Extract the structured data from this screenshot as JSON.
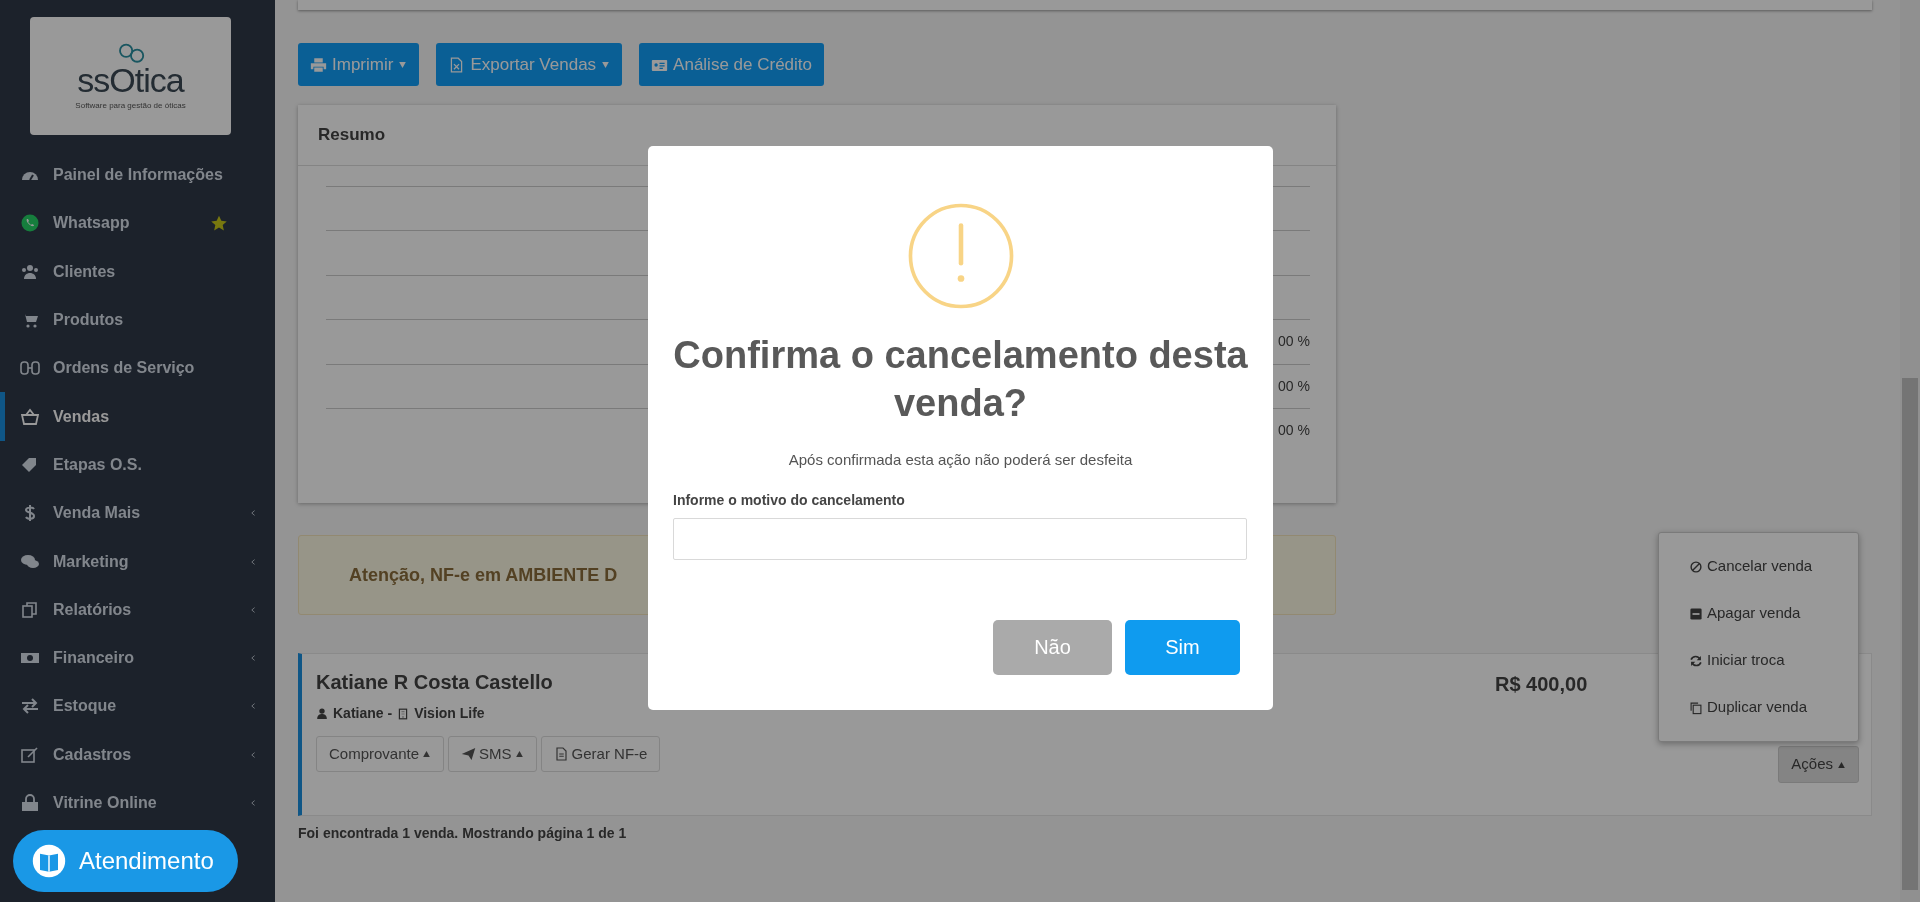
{
  "sidebar": {
    "logo": {
      "text": "ssOtica",
      "tagline": "Software para gestão de óticas"
    },
    "items": [
      {
        "label": "Painel de Informações",
        "selected": false,
        "starred": false,
        "expandable": false
      },
      {
        "label": "Whatsapp",
        "selected": false,
        "starred": true,
        "expandable": false
      },
      {
        "label": "Clientes",
        "selected": false,
        "starred": false,
        "expandable": false
      },
      {
        "label": "Produtos",
        "selected": false,
        "starred": false,
        "expandable": false
      },
      {
        "label": "Ordens de Serviço",
        "selected": false,
        "starred": false,
        "expandable": false
      },
      {
        "label": "Vendas",
        "selected": true,
        "starred": false,
        "expandable": false
      },
      {
        "label": "Etapas O.S.",
        "selected": false,
        "starred": false,
        "expandable": false
      },
      {
        "label": "Venda Mais",
        "selected": false,
        "starred": false,
        "expandable": true
      },
      {
        "label": "Marketing",
        "selected": false,
        "starred": false,
        "expandable": true
      },
      {
        "label": "Relatórios",
        "selected": false,
        "starred": false,
        "expandable": true
      },
      {
        "label": "Financeiro",
        "selected": false,
        "starred": false,
        "expandable": true
      },
      {
        "label": "Estoque",
        "selected": false,
        "starred": false,
        "expandable": true
      },
      {
        "label": "Cadastros",
        "selected": false,
        "starred": false,
        "expandable": true
      },
      {
        "label": "Vitrine Online",
        "selected": false,
        "starred": false,
        "expandable": true
      }
    ]
  },
  "toolbar": [
    {
      "label": "Imprimir",
      "caret": true
    },
    {
      "label": "Exportar Vendas",
      "caret": true
    },
    {
      "label": "Análise de Crédito",
      "caret": false
    }
  ],
  "resumo": {
    "title": "Resumo",
    "rows": [
      {
        "kind": "blank"
      },
      {
        "kind": "blank"
      },
      {
        "kind": "blank"
      },
      {
        "kind": "value",
        "column_last": "00 %"
      },
      {
        "kind": "value",
        "column_last": "00 %"
      },
      {
        "kind": "value",
        "column_last": "00 %"
      }
    ]
  },
  "alert": "Atenção, NF-e em AMBIENTE D",
  "sale": {
    "customer": "Katiane R Costa Castello",
    "seller": "Katiane -",
    "store": "Vision Life",
    "total": "R$ 400,00",
    "buttons": [
      {
        "label": "Comprovante",
        "caret": true
      },
      {
        "label": "SMS",
        "caret": true
      },
      {
        "label": "Gerar NF-e",
        "caret": false
      }
    ],
    "actions": {
      "label": "Ações",
      "expanded": true,
      "items": [
        "Cancelar venda",
        "Apagar venda",
        "Iniciar troca",
        "Duplicar venda"
      ]
    }
  },
  "footer": "Foi encontrada 1 venda. Mostrando página 1 de 1",
  "dialog": {
    "title": "Confirma o cancelamento desta venda?",
    "message": "Após confirmada esta ação não poderá ser desfeita",
    "field_label": "Informe o motivo do cancelamento",
    "buttons": [
      {
        "label": "Não",
        "kind": "cancel"
      },
      {
        "label": "Sim",
        "kind": "confirm"
      }
    ]
  },
  "chat_button": "Atendimento"
}
